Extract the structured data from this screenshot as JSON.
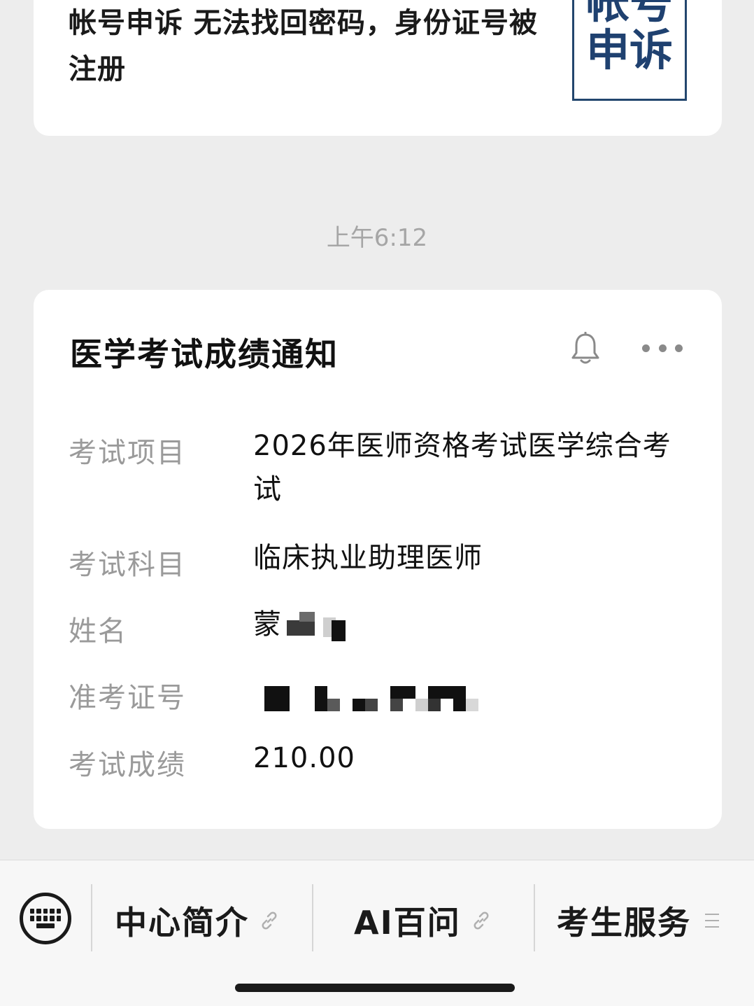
{
  "article": {
    "title": "帐号申诉 无法找回密码，身份证号被注册",
    "thumb_line1": "帐号",
    "thumb_line2": "申诉",
    "thumb_caption": "..."
  },
  "timestamp": "上午6:12",
  "notice": {
    "title": "医学考试成绩通知",
    "fields": [
      {
        "label": "考试项目",
        "value": "2026年医师资格考试医学综合考试"
      },
      {
        "label": "考试科目",
        "value": "临床执业助理医师"
      },
      {
        "label": "姓名",
        "value": "蒙"
      },
      {
        "label": "准考证号",
        "value": ""
      },
      {
        "label": "考试成绩",
        "value": "210.00"
      }
    ]
  },
  "menu": {
    "items": [
      {
        "label": "中心简介"
      },
      {
        "label": "AI百问"
      },
      {
        "label": "考生服务"
      }
    ]
  },
  "icons": {
    "keyboard": "keyboard-icon",
    "bell": "bell-icon",
    "more": "more-icon",
    "link": "link-icon",
    "list": "list-icon"
  },
  "colors": {
    "background": "#ededed",
    "card": "#ffffff",
    "label": "#9a9a9a",
    "thumb_blue": "#1f4170"
  }
}
